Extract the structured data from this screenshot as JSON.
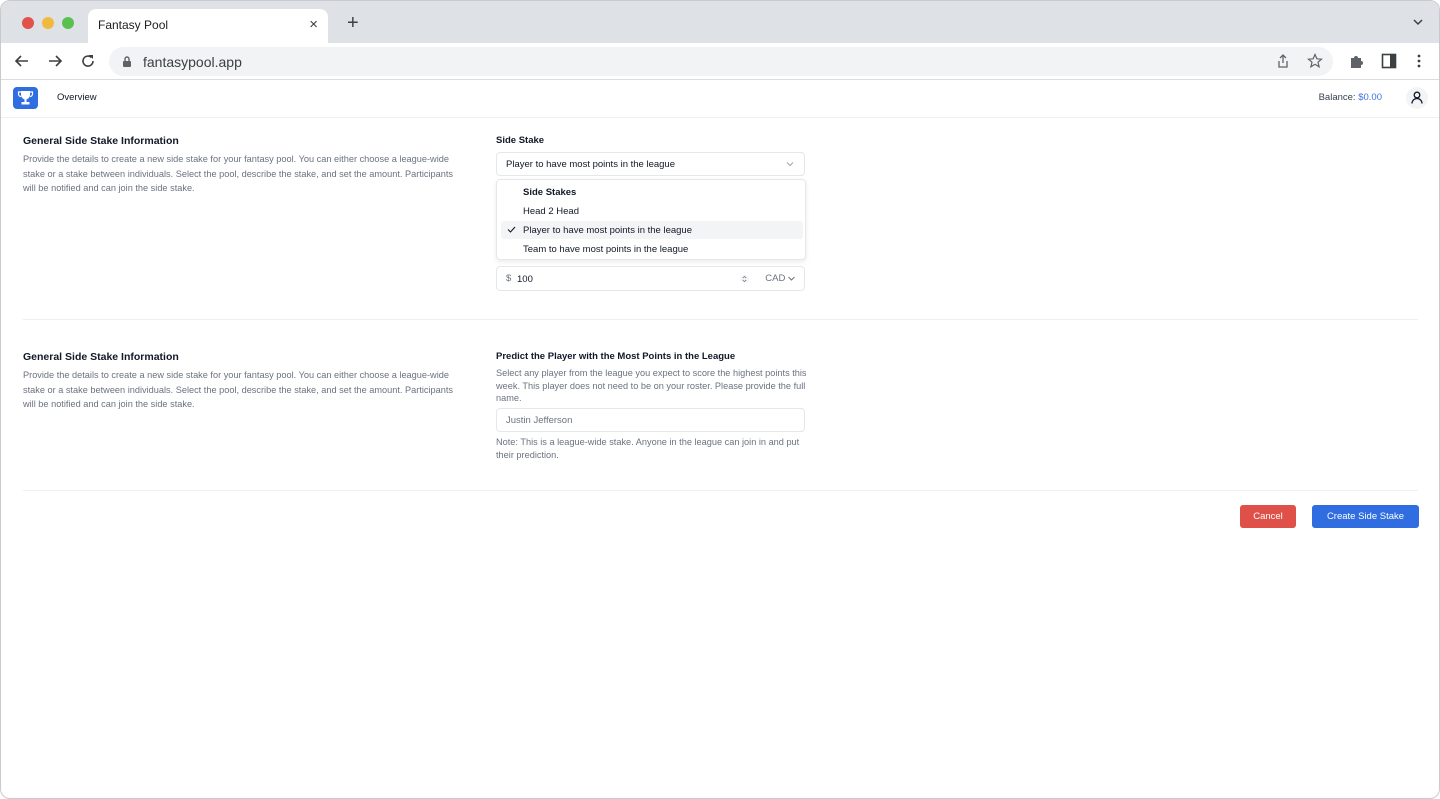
{
  "browser": {
    "tab_title": "Fantasy Pool",
    "tab_close_icon": "×",
    "new_tab_icon": "+",
    "url": "fantasypool.app"
  },
  "header": {
    "nav_overview": "Overview",
    "balance_label": "Balance:",
    "balance_amount": "$0.00"
  },
  "section1": {
    "title": "General Side Stake Information",
    "description": "Provide the details to create a new side stake for your fantasy pool. You can either choose a league-wide stake or a stake between individuals. Select the pool, describe the stake, and set the amount. Participants will be notified and can join the side stake.",
    "side_stake_label": "Side Stake",
    "side_stake_value": "Player to have most points in the league",
    "dropdown": {
      "heading": "Side Stakes",
      "options": [
        {
          "label": "Head 2 Head",
          "selected": false
        },
        {
          "label": "Player to have most points in the league",
          "selected": true
        },
        {
          "label": "Team to have most points in the league",
          "selected": false
        }
      ]
    },
    "amount": {
      "currency_symbol": "$",
      "value": "100",
      "currency": "CAD"
    }
  },
  "section2": {
    "title": "General Side Stake Information",
    "description": "Provide the details to create a new side stake for your fantasy pool. You can either choose a league-wide stake or a stake between individuals. Select the pool, describe the stake, and set the amount. Participants will be notified and can join the side stake.",
    "field_label": "Predict the Player with the Most Points in the League",
    "field_description": "Select any player from the league you expect to score the highest points this week. This player does not need to be on your roster. Please provide the full name.",
    "player_placeholder": "Justin Jefferson",
    "note": "Note: This is a league-wide stake. Anyone in the league can join in and put their prediction."
  },
  "actions": {
    "cancel_label": "Cancel",
    "create_label": "Create Side Stake"
  },
  "colors": {
    "primary": "#2f6de1",
    "danger": "#df5148",
    "balance": "#3b72e0"
  }
}
